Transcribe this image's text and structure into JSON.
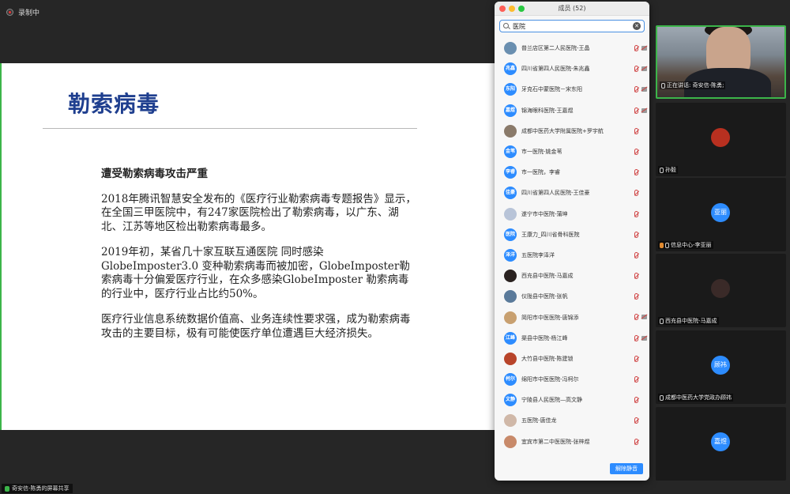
{
  "top": {
    "recording_label": "录制中"
  },
  "slide": {
    "title": "勒索病毒",
    "subtitle": "遭受勒索病毒攻击严重",
    "paragraphs": [
      "2018年腾讯智慧安全发布的《医疗行业勒索病毒专题报告》显示，在全国三甲医院中，有247家医院检出了勒索病毒，以广东、湖北、江苏等地区检出勒索病毒最多。",
      "2019年初，某省几十家互联互通医院 同时感染GlobeImposter3.0 变种勒索病毒而被加密，GlobeImposter勒索病毒十分偏爱医疗行业，在众多感染GlobeImposter 勒索病毒的行业中，医疗行业占比约50%。",
      "医疗行业信息系统数据价值高、业务连续性要求强，成为勒索病毒攻击的主要目标，极有可能使医疗单位遭遇巨大经济损失。"
    ]
  },
  "panel": {
    "title": "成员 (52)",
    "search_value": "医院",
    "unmute_all_label": "解除静音",
    "participants": [
      {
        "name": "普兰店区第二人民医院-王晶",
        "avatar_text": "",
        "avatar_color": "#6a8fb0",
        "cam_off": true
      },
      {
        "name": "四川省第四人民医院-朱兆鑫",
        "avatar_text": "兆鑫",
        "avatar_color": "#2d8cff",
        "cam_off": true
      },
      {
        "name": "牙克石中蒙医院－宋东阳",
        "avatar_text": "东阳",
        "avatar_color": "#2d8cff",
        "cam_off": true
      },
      {
        "name": "锦海眼科医院-王嘉煜",
        "avatar_text": "嘉煜",
        "avatar_color": "#2d8cff",
        "cam_off": true
      },
      {
        "name": "成都中医药大学附属医院+罗宇航",
        "avatar_text": "",
        "avatar_color": "#8a7a6a",
        "cam_off": false
      },
      {
        "name": "市一医院-姚金苇",
        "avatar_text": "金苇",
        "avatar_color": "#2d8cff",
        "cam_off": false
      },
      {
        "name": "市一医院，李睿",
        "avatar_text": "李睿",
        "avatar_color": "#2d8cff",
        "cam_off": false
      },
      {
        "name": "四川省第四人民医院-王佳豪",
        "avatar_text": "佳豪",
        "avatar_color": "#2d8cff",
        "cam_off": false
      },
      {
        "name": "遂宁市中医院-蒲坤",
        "avatar_text": "",
        "avatar_color": "#b8c4d8",
        "cam_off": false
      },
      {
        "name": "王康力_四川省骨科医院",
        "avatar_text": "医院",
        "avatar_color": "#2d8cff",
        "cam_off": false
      },
      {
        "name": "五医院李泽洋",
        "avatar_text": "泽洋",
        "avatar_color": "#2d8cff",
        "cam_off": false
      },
      {
        "name": "西充县中医院-马嘉成",
        "avatar_text": "",
        "avatar_color": "#2a2220",
        "cam_off": false
      },
      {
        "name": "仪陇县中医院-张帆",
        "avatar_text": "",
        "avatar_color": "#5a7a9a",
        "cam_off": false
      },
      {
        "name": "简阳市中医医院-唐锦添",
        "avatar_text": "",
        "avatar_color": "#c8a070",
        "cam_off": true
      },
      {
        "name": "渠县中医院-杨江峰",
        "avatar_text": "江峰",
        "avatar_color": "#2d8cff",
        "cam_off": true
      },
      {
        "name": "大竹县中医院-陈建锁",
        "avatar_text": "",
        "avatar_color": "#b8442a",
        "cam_off": false
      },
      {
        "name": "绵阳市中医医院-冯柯尔",
        "avatar_text": "柯尔",
        "avatar_color": "#2d8cff",
        "cam_off": false
      },
      {
        "name": "宁陵县人民医院—高文静",
        "avatar_text": "文静",
        "avatar_color": "#2d8cff",
        "cam_off": false
      },
      {
        "name": "五医院-唐佳龙",
        "avatar_text": "",
        "avatar_color": "#d0b8a8",
        "cam_off": false
      },
      {
        "name": "宜宾市第二中医医院-张梓煜",
        "avatar_text": "",
        "avatar_color": "#c88a6a",
        "cam_off": false
      }
    ]
  },
  "tiles": [
    {
      "label": "正在讲话: 奇安信-陈勇;",
      "avatar_text": ""
    },
    {
      "label": "孙毅",
      "avatar_text": ""
    },
    {
      "label": "信息中心-李亚丽",
      "avatar_text": "亚丽"
    },
    {
      "label": "西充县中医院-马嘉成",
      "avatar_text": ""
    },
    {
      "label": "成都中医药大学党政办顾祎",
      "avatar_text": "顾祎"
    },
    {
      "label": "",
      "avatar_text": "嘉煜"
    }
  ],
  "bottom": {
    "share_label": "奇安信-陈勇的屏幕共享"
  }
}
